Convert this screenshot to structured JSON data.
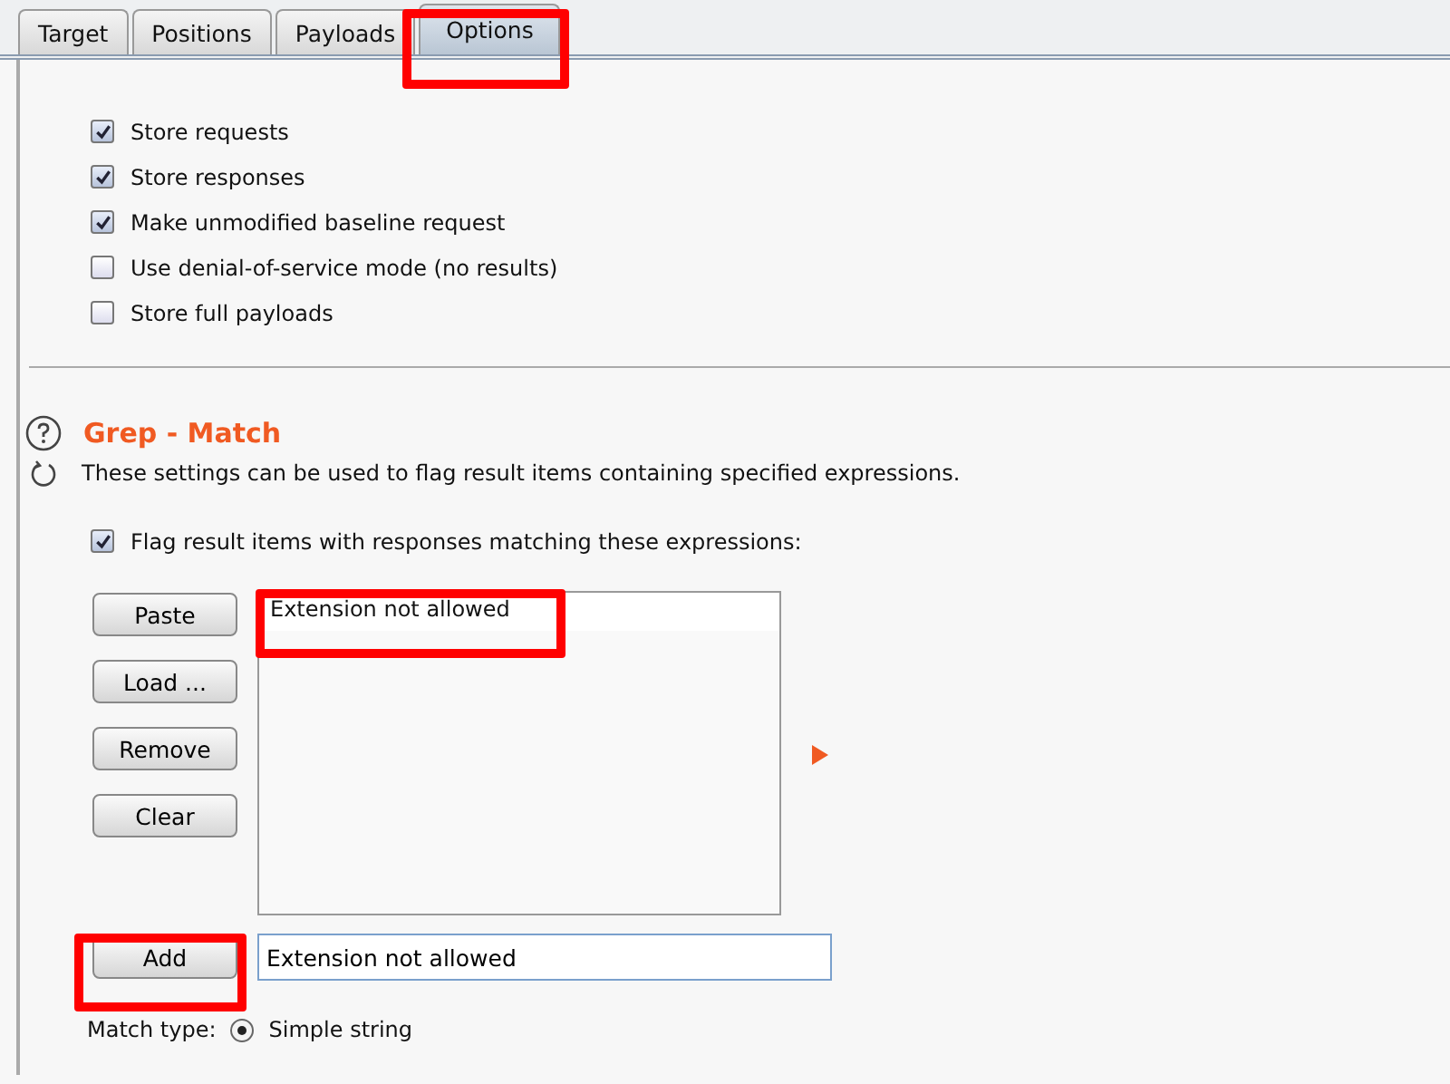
{
  "tabs": [
    {
      "label": "Target",
      "selected": false
    },
    {
      "label": "Positions",
      "selected": false
    },
    {
      "label": "Payloads",
      "selected": false
    },
    {
      "label": "Options",
      "selected": true
    }
  ],
  "store_options": [
    {
      "label": "Store requests",
      "checked": true
    },
    {
      "label": "Store responses",
      "checked": true
    },
    {
      "label": "Make unmodified baseline request",
      "checked": true
    },
    {
      "label": "Use denial-of-service mode (no results)",
      "checked": false
    },
    {
      "label": "Store full payloads",
      "checked": false
    }
  ],
  "grep_match": {
    "title": "Grep - Match",
    "description": "These settings can be used to flag result items containing specified expressions.",
    "flag_option": {
      "label": "Flag result items with responses matching these expressions:",
      "checked": true
    },
    "list_buttons": [
      "Paste",
      "Load ...",
      "Remove",
      "Clear"
    ],
    "expressions": [
      "Extension not allowed"
    ],
    "add_button": "Add",
    "add_field": {
      "value": "Extension not allowed"
    },
    "match_type": {
      "label": "Match type:",
      "options": [
        {
          "label": "Simple string",
          "selected": true
        }
      ]
    }
  }
}
